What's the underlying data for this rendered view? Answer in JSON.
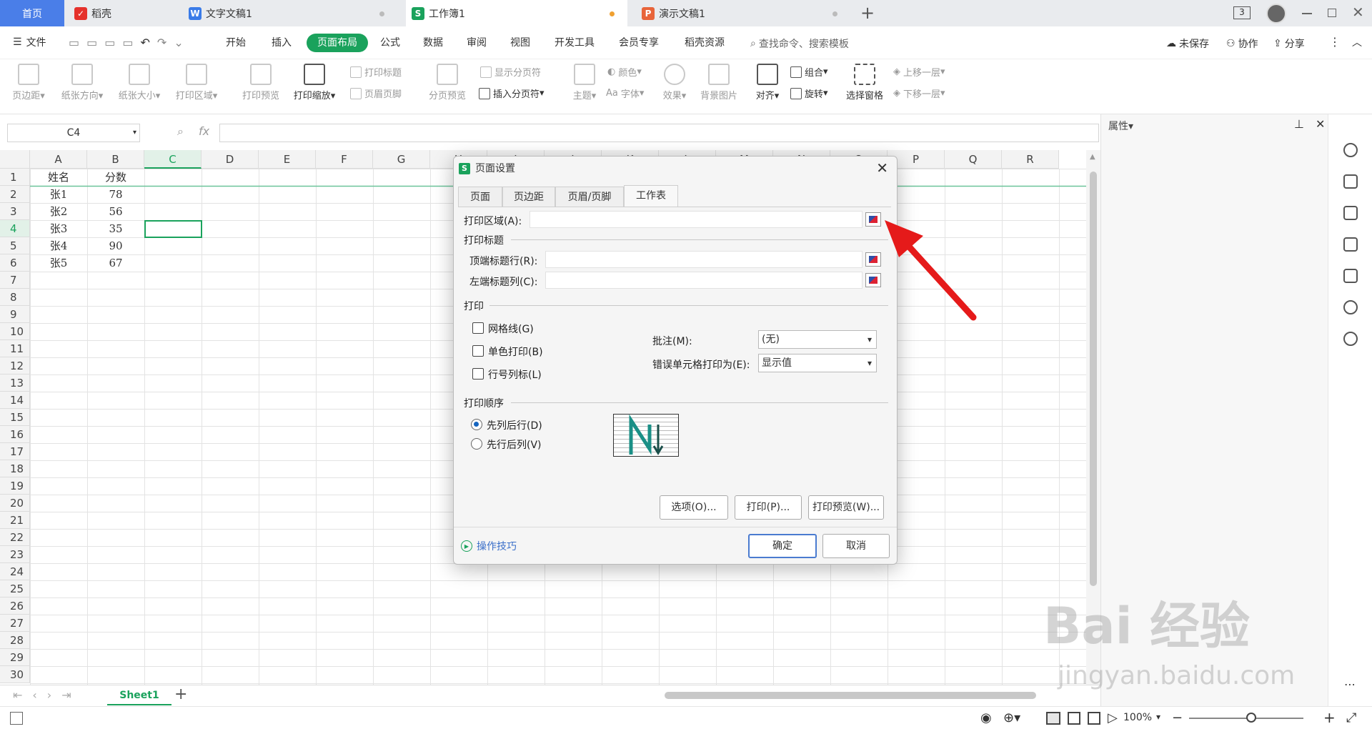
{
  "tabs": [
    {
      "label": "首页"
    },
    {
      "label": "稻壳",
      "icon": "daoke-icon"
    },
    {
      "label": "文字文稿1",
      "icon": "writer-icon"
    },
    {
      "label": "工作簿1",
      "icon": "spreadsheet-icon"
    },
    {
      "label": "演示文稿1",
      "icon": "presentation-icon"
    }
  ],
  "tab_badge": "3",
  "menubar": {
    "file": "文件",
    "items": [
      "开始",
      "插入",
      "页面布局",
      "公式",
      "数据",
      "审阅",
      "视图",
      "开发工具",
      "会员专享",
      "稻壳资源"
    ],
    "active": "页面布局",
    "search": "查找命令、搜索模板",
    "unsaved": "未保存",
    "collab": "协作",
    "share": "分享"
  },
  "ribbon": {
    "margins": "页边距",
    "orientation": "纸张方向",
    "size": "纸张大小",
    "print_area": "打印区域",
    "print_preview": "打印预览",
    "print_scale": "打印缩放",
    "print_titles": "打印标题",
    "header_footer": "页眉页脚",
    "page_break_preview": "分页预览",
    "show_breaks": "显示分页符",
    "insert_break": "插入分页符",
    "theme": "主题",
    "colors": "颜色",
    "fonts": "字体",
    "effects": "效果",
    "background": "背景图片",
    "align": "对齐",
    "group": "组合",
    "rotate": "旋转",
    "selection_pane": "选择窗格",
    "bring_forward": "上移一层",
    "send_backward": "下移一层"
  },
  "namebox": "C4",
  "fx": "fx",
  "columns": [
    "A",
    "B",
    "C",
    "D",
    "E",
    "F",
    "G",
    "H",
    "I",
    "J",
    "K",
    "L",
    "M",
    "N",
    "O",
    "P",
    "Q",
    "R"
  ],
  "rows": [
    "1",
    "2",
    "3",
    "4",
    "5",
    "6",
    "7",
    "8",
    "9",
    "10",
    "11",
    "12",
    "13",
    "14",
    "15",
    "16",
    "17",
    "18",
    "19",
    "20",
    "21",
    "22",
    "23",
    "24",
    "25",
    "26",
    "27",
    "28",
    "29",
    "30"
  ],
  "cells": [
    [
      "姓名",
      "分数"
    ],
    [
      "张1",
      "78"
    ],
    [
      "张2",
      "56"
    ],
    [
      "张3",
      "35"
    ],
    [
      "张4",
      "90"
    ],
    [
      "张5",
      "67"
    ]
  ],
  "sheet": "Sheet1",
  "right_panel_title": "属性",
  "zoom": "100%",
  "dialog": {
    "title": "页面设置",
    "tabs": [
      "页面",
      "页边距",
      "页眉/页脚",
      "工作表"
    ],
    "active_tab": "工作表",
    "print_area_label": "打印区域(A):",
    "print_titles_label": "打印标题",
    "top_rows_label": "顶端标题行(R):",
    "left_cols_label": "左端标题列(C):",
    "print_label": "打印",
    "gridlines": "网格线(G)",
    "mono": "单色打印(B)",
    "headings": "行号列标(L)",
    "comments_label": "批注(M):",
    "comments_value": "(无)",
    "errors_label": "错误单元格打印为(E):",
    "errors_value": "显示值",
    "order_label": "打印顺序",
    "down_then_over": "先列后行(D)",
    "over_then_down": "先行后列(V)",
    "options_btn": "选项(O)...",
    "print_btn": "打印(P)...",
    "preview_btn": "打印预览(W)...",
    "tips": "操作技巧",
    "ok": "确定",
    "cancel": "取消"
  },
  "watermark": {
    "logo": "Bai 经验",
    "url": "jingyan.baidu.com"
  }
}
